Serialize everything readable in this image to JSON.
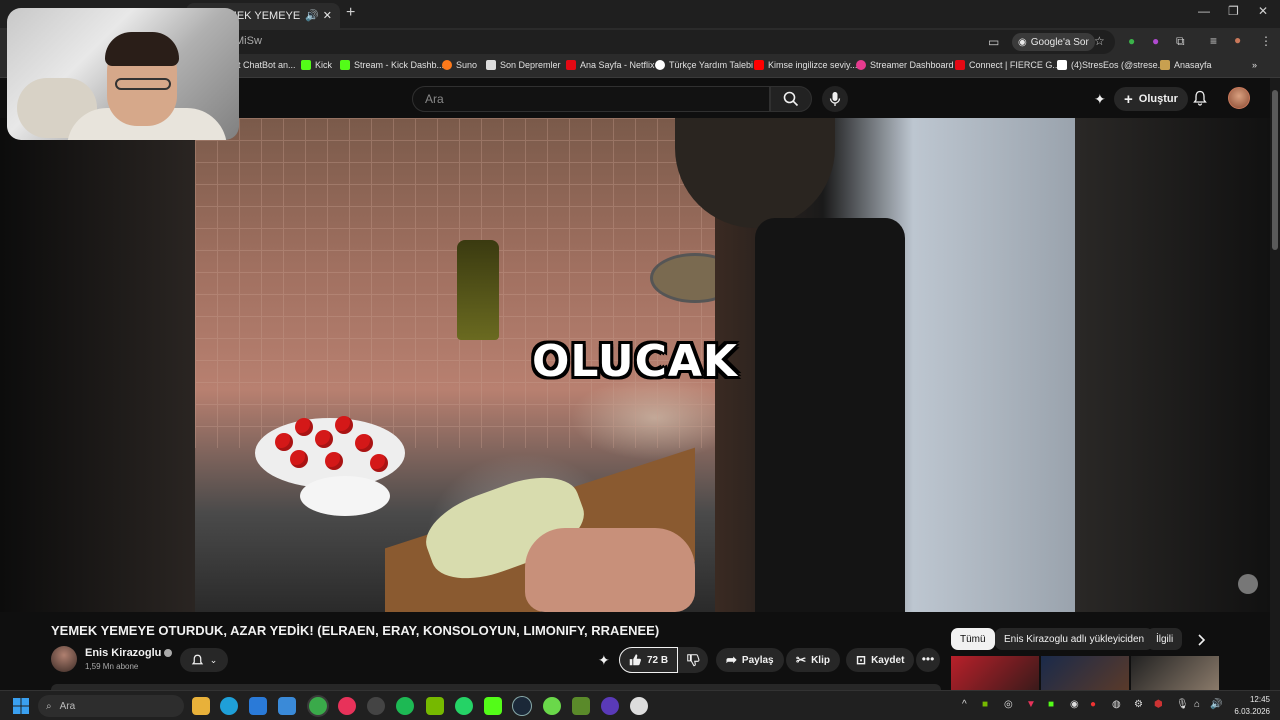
{
  "browser": {
    "tab_title": "YEMEK YEMEYE OTURDUK,",
    "url_fragment": "MiSw",
    "google_sor": "Google'a Sor"
  },
  "bookmarks": [
    {
      "label": "t ChatBot an...",
      "color": "#4a90e2"
    },
    {
      "label": "Kick",
      "color": "#53fc18"
    },
    {
      "label": "Stream - Kick Dashb...",
      "color": "#53fc18"
    },
    {
      "label": "Suno",
      "color": "#ff7a1a"
    },
    {
      "label": "Son Depremler",
      "color": "#dddddd"
    },
    {
      "label": "Ana Sayfa - Netflix",
      "color": "#e50914"
    },
    {
      "label": "Türkçe Yardım Talebi",
      "color": "#ffffff"
    },
    {
      "label": "Kimse ingilizce seviy...",
      "color": "#ff0000"
    },
    {
      "label": "Streamer Dashboard",
      "color": "#e63b8f"
    },
    {
      "label": "Connect | FIERCE G...",
      "color": "#e50914"
    },
    {
      "label": "(4)StresEos (@strese...",
      "color": "#ffffff"
    },
    {
      "label": "Anasayfa",
      "color": "#c8a050"
    }
  ],
  "youtube": {
    "search_placeholder": "Ara",
    "create_label": "Oluştur"
  },
  "player": {
    "caption": "OLUCAK"
  },
  "video": {
    "title": "YEMEK YEMEYE OTURDUK, AZAR YEDİK! (ELRAEN, ERAY, KONSOLOYUN, LIMONIFY, RRAENEE)",
    "channel_name": "Enis Kirazoglu",
    "subscribers": "1,59 Mn abone",
    "likes": "72 B",
    "share_label": "Paylaş",
    "clip_label": "Klip",
    "save_label": "Kaydet"
  },
  "chips": [
    {
      "label": "Tümü",
      "active": true
    },
    {
      "label": "Enis Kirazoglu adlı yükleyiciden",
      "active": false
    },
    {
      "label": "İlgili",
      "active": false
    }
  ],
  "taskbar": {
    "search_placeholder": "Ara",
    "time": "12:45",
    "date": "6.03.2026"
  },
  "colors": {
    "youtube_bg": "#0f0f0f",
    "chip_bg": "#272727",
    "accent_red": "#ff0000"
  }
}
